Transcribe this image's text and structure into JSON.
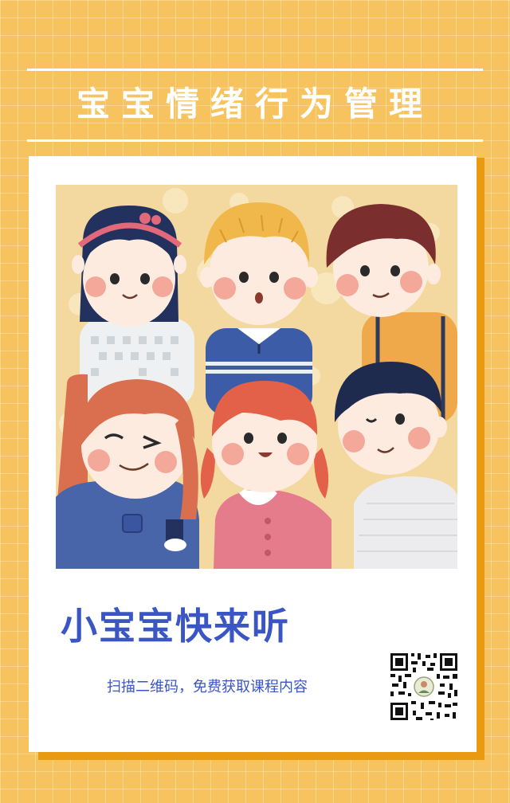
{
  "poster": {
    "title": "宝宝情绪行为管理",
    "headline": "小宝宝快来听",
    "subtitle": "扫描二维码，免费获取课程内容"
  },
  "colors": {
    "background": "#f7c35e",
    "card_shadow": "#e79a12",
    "accent_blue": "#3a55c4",
    "illustration_bg": "#f3d9a0"
  },
  "illustration": {
    "subject": "six cartoon children",
    "icons": [
      "girl-headband-icon",
      "blond-boy-icon",
      "brown-hair-boy-icon",
      "ponytail-girl-icon",
      "pigtail-girl-icon",
      "dark-hair-boy-icon"
    ]
  },
  "qr_code": {
    "icon": "qr-code-icon"
  }
}
